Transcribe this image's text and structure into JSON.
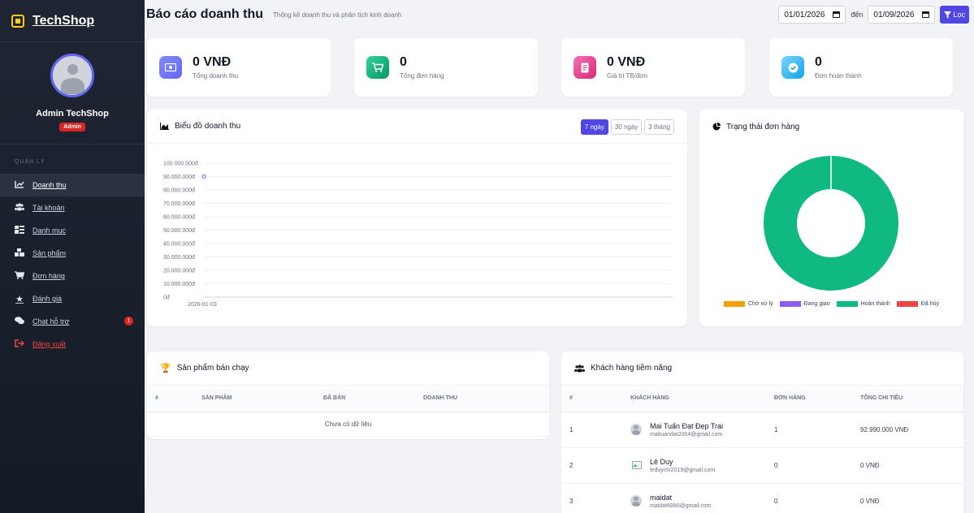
{
  "brand": {
    "name": "TechShop"
  },
  "profile": {
    "name": "Admin TechShop",
    "role": "Admin"
  },
  "sidebar": {
    "section": "QUẢN LÝ",
    "items": [
      {
        "label": "Doanh thu",
        "icon": "chart-line-icon"
      },
      {
        "label": "Tài khoản",
        "icon": "users-icon"
      },
      {
        "label": "Danh mục",
        "icon": "tags-icon"
      },
      {
        "label": "Sản phẩm",
        "icon": "boxes-icon"
      },
      {
        "label": "Đơn hàng",
        "icon": "cart-icon"
      },
      {
        "label": "Đánh giá",
        "icon": "star-icon"
      },
      {
        "label": "Chat hỗ trợ",
        "icon": "chat-icon",
        "badge": "1"
      },
      {
        "label": "Đăng xuất",
        "icon": "logout-icon"
      }
    ]
  },
  "header": {
    "title": "Báo cáo doanh thu",
    "subtitle": "Thống kê doanh thu và phân tích kinh doanh",
    "date_from": "01/01/2026",
    "date_sep": "đến",
    "date_to": "01/09/2026",
    "filter_label": "Lọc"
  },
  "stats": [
    {
      "value": "0 VNĐ",
      "label": "Tổng doanh thu",
      "color": "#6366f1"
    },
    {
      "value": "0",
      "label": "Tổng đơn hàng",
      "color": "#10b981"
    },
    {
      "value": "0 VNĐ",
      "label": "Giá trị TB/đơn",
      "color": "#ec4899"
    },
    {
      "value": "0",
      "label": "Đơn hoàn thành",
      "color": "#38bdf8"
    }
  ],
  "revenue_panel": {
    "title": "Biểu đồ doanh thu",
    "ranges": [
      "7 ngày",
      "30 ngày",
      "3 tháng"
    ]
  },
  "status_panel": {
    "title": "Trạng thái đơn hàng"
  },
  "chart_data": [
    {
      "type": "line",
      "title": "Biểu đồ doanh thu",
      "x": [
        "2026-01-03"
      ],
      "series": [
        {
          "values": [
            90000000
          ]
        }
      ],
      "yticks": [
        "100.000.000đ",
        "90.000.000đ",
        "80.000.000đ",
        "70.000.000đ",
        "60.000.000đ",
        "50.000.000đ",
        "40.000.000đ",
        "30.000.000đ",
        "20.000.000đ",
        "10.000.000đ",
        "0đ"
      ],
      "ylim": [
        0,
        100000000
      ],
      "grid": true,
      "color": "#6366f1"
    },
    {
      "type": "pie",
      "title": "Trạng thái đơn hàng",
      "donut": true,
      "categories": [
        "Chờ xử lý",
        "Đang giao",
        "Hoàn thành",
        "Đã hủy"
      ],
      "values": [
        0,
        0,
        1,
        0
      ],
      "colors": [
        "#f59e0b",
        "#8b5cf6",
        "#10b981",
        "#ef4444"
      ],
      "legend": "bottom"
    }
  ],
  "top_products": {
    "title": "Sản phẩm bán chạy",
    "columns": [
      "#",
      "SẢN PHẨM",
      "ĐÃ BÁN",
      "DOANH THU"
    ],
    "empty": "Chưa có dữ liệu"
  },
  "customers": {
    "title": "Khách hàng tiềm năng",
    "columns": [
      "#",
      "KHÁCH HÀNG",
      "ĐƠN HÀNG",
      "TỔNG CHI TIÊU"
    ],
    "rows": [
      {
        "rank": "1",
        "name": "Mai Tuấn Đạt Đẹp Trai",
        "email": "maituandat2004@gmail.com",
        "orders": "1",
        "total": "92.990.000 VNĐ"
      },
      {
        "rank": "2",
        "name": "Lê Duy",
        "email": "leduyctv2019@gmail.com",
        "orders": "0",
        "total": "0 VNĐ"
      },
      {
        "rank": "3",
        "name": "maidat",
        "email": "maidat6890@gmail.com",
        "orders": "0",
        "total": "0 VNĐ"
      }
    ]
  }
}
